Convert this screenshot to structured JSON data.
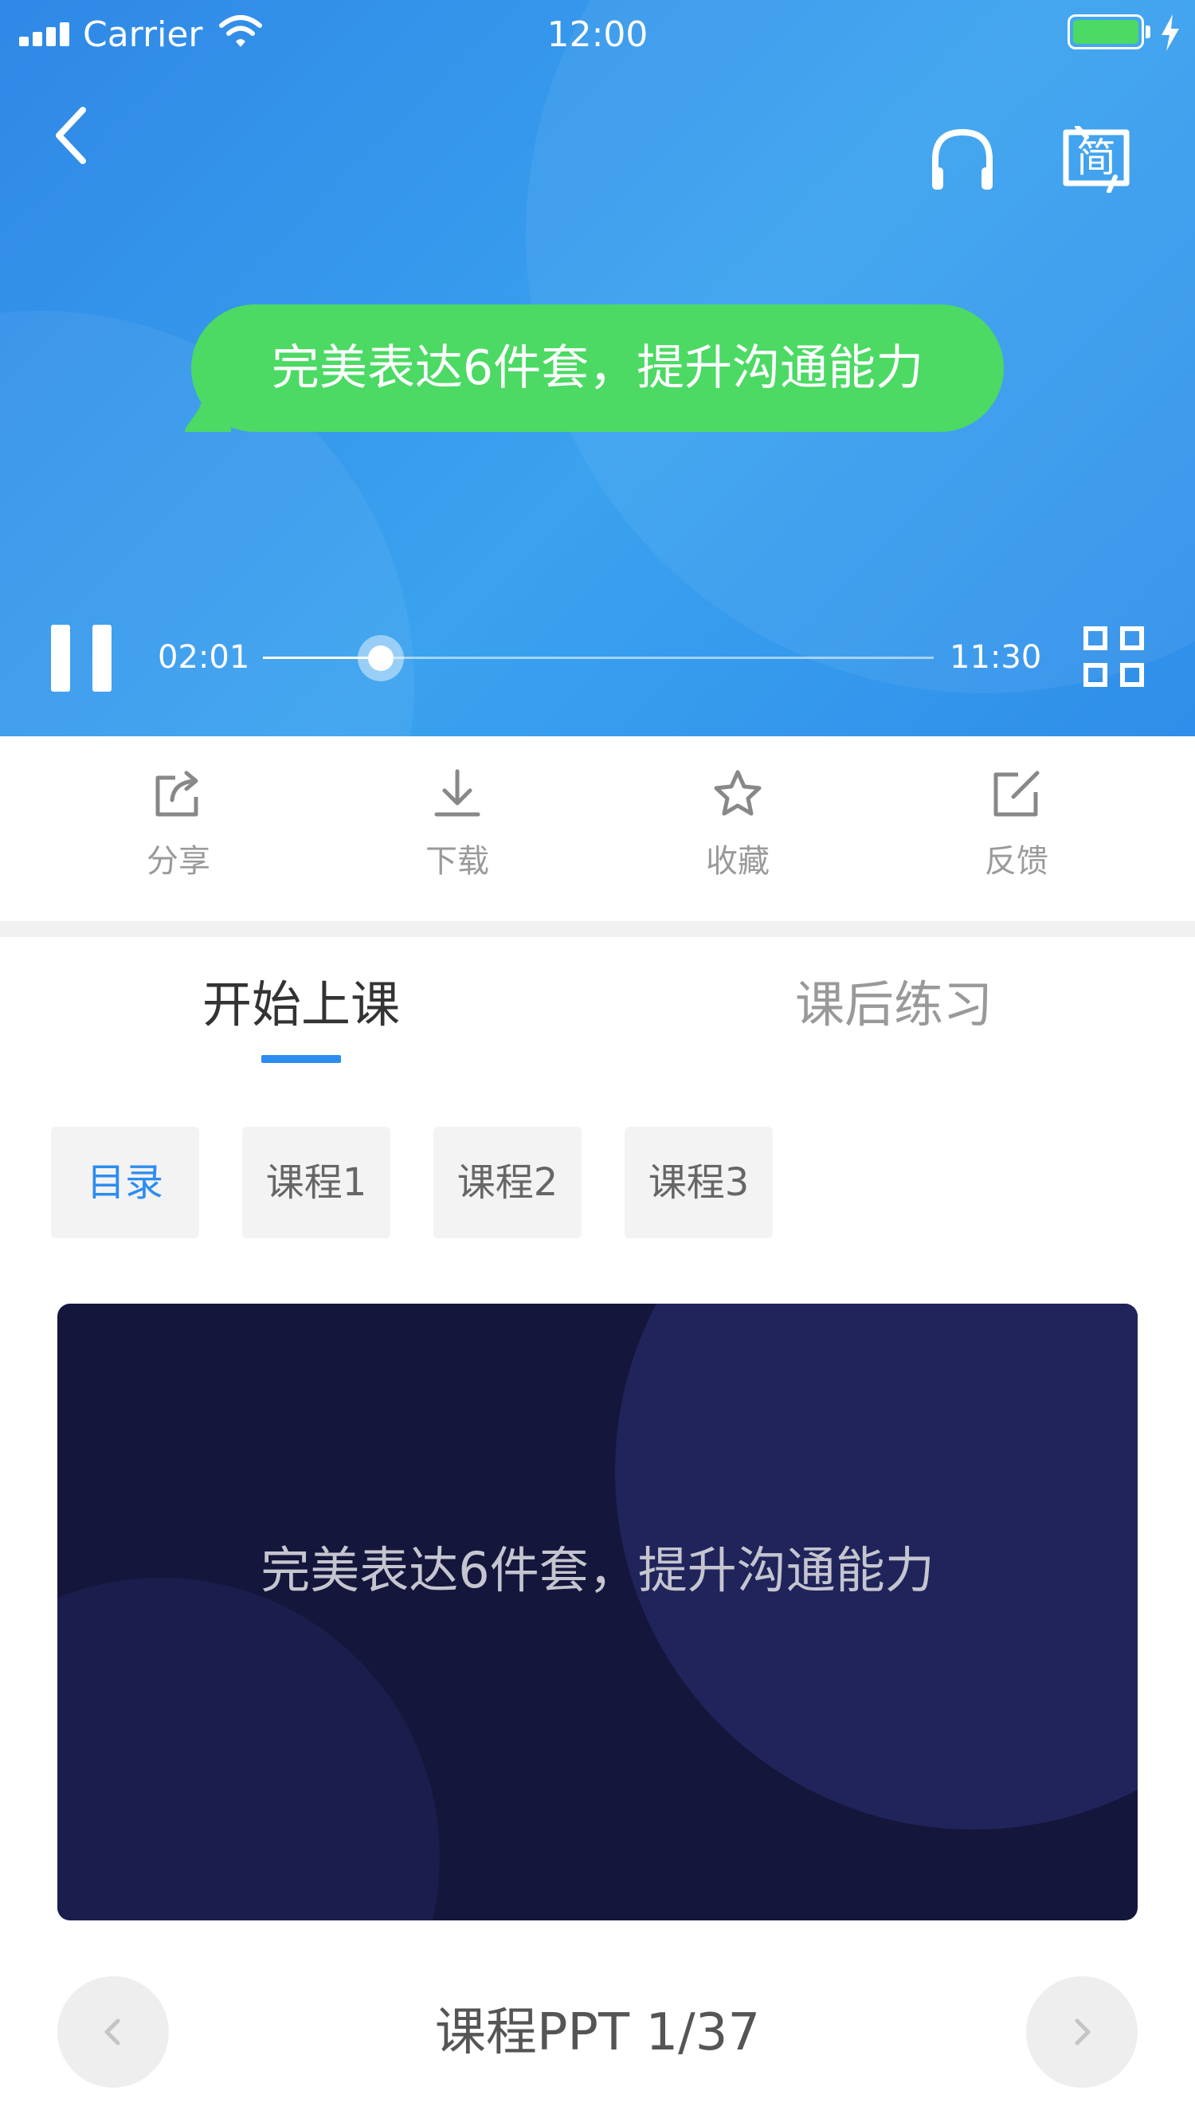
{
  "status_bar": {
    "carrier": "Carrier",
    "time": "12:00",
    "battery_color": "#4cd964"
  },
  "player": {
    "back_icon": "chevron-left-icon",
    "audio_icon": "headphones-icon",
    "language_toggle": "简",
    "subtitle": "完美表达6件套，提升沟通能力",
    "bubble_color": "#4cd964",
    "current_time": "02:01",
    "total_time": "11:30",
    "progress_fraction": 0.176,
    "pause_icon": "pause-icon",
    "grid_icon": "grid-icon"
  },
  "actions": [
    {
      "label": "分享",
      "icon": "share-icon"
    },
    {
      "label": "下载",
      "icon": "download-icon"
    },
    {
      "label": "收藏",
      "icon": "star-icon"
    },
    {
      "label": "反馈",
      "icon": "feedback-edit-icon"
    }
  ],
  "tabs": [
    {
      "label": "开始上课",
      "active": true
    },
    {
      "label": "课后练习",
      "active": false
    }
  ],
  "accent_color": "#2d8cf0",
  "chips": [
    {
      "label": "目录",
      "active": true
    },
    {
      "label": "课程1",
      "active": false
    },
    {
      "label": "课程2",
      "active": false
    },
    {
      "label": "课程3",
      "active": false
    }
  ],
  "slide": {
    "title": "完美表达6件套，提升沟通能力",
    "background_color": "#15163b"
  },
  "pager": {
    "label": "课程PPT 1/37",
    "prev_icon": "chevron-left-icon",
    "next_icon": "chevron-right-icon"
  }
}
